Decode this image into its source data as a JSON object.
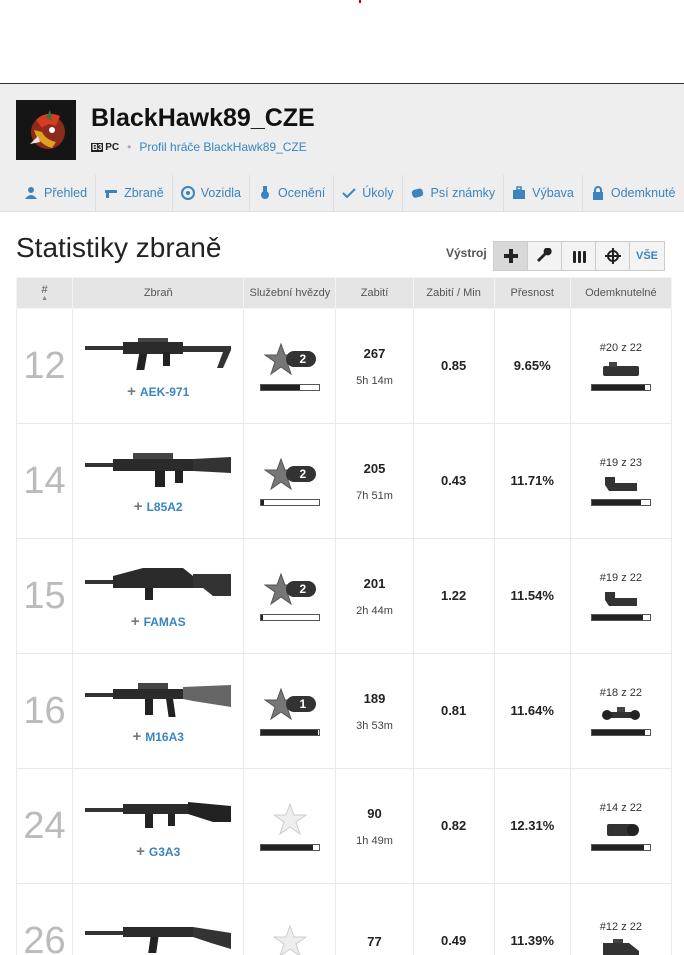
{
  "player": {
    "name": "BlackHawk89_CZE",
    "platform": "PC",
    "profile_link": "Profil hráče BlackHawk89_CZE"
  },
  "nav": [
    {
      "label": "Přehled",
      "icon": "user-icon"
    },
    {
      "label": "Zbraně",
      "icon": "gun-icon"
    },
    {
      "label": "Vozidla",
      "icon": "wheel-icon"
    },
    {
      "label": "Ocenění",
      "icon": "medal-icon"
    },
    {
      "label": "Úkoly",
      "icon": "check-icon"
    },
    {
      "label": "Psí známky",
      "icon": "dogtag-icon"
    },
    {
      "label": "Výbava",
      "icon": "briefcase-icon"
    },
    {
      "label": "Odemknuté",
      "icon": "lock-icon"
    }
  ],
  "page": {
    "title": "Statistiky zbraně",
    "filter_label": "Výstroj",
    "filter_all": "VŠE"
  },
  "table": {
    "headers": {
      "rank": "#",
      "weapon": "Zbraň",
      "stars": "Služební hvězdy",
      "kills": "Zabití",
      "kpm": "Zabití / Min",
      "accuracy": "Přesnost",
      "unlocks": "Odemknutelné"
    },
    "rows": [
      {
        "rank": "12",
        "weapon": "AEK-971",
        "stars": "2",
        "star_progress": 0.68,
        "kills": "267",
        "time": "5h 14m",
        "kpm": "0.85",
        "accuracy": "9.65%",
        "unlock": "#20 z 22",
        "unlock_progress": 0.92
      },
      {
        "rank": "14",
        "weapon": "L85A2",
        "stars": "2",
        "star_progress": 0.05,
        "kills": "205",
        "time": "7h 51m",
        "kpm": "0.43",
        "accuracy": "11.71%",
        "unlock": "#19 z 23",
        "unlock_progress": 0.85
      },
      {
        "rank": "15",
        "weapon": "FAMAS",
        "stars": "2",
        "star_progress": 0.03,
        "kills": "201",
        "time": "2h 44m",
        "kpm": "1.22",
        "accuracy": "11.54%",
        "unlock": "#19 z 22",
        "unlock_progress": 0.88
      },
      {
        "rank": "16",
        "weapon": "M16A3",
        "stars": "1",
        "star_progress": 0.98,
        "kills": "189",
        "time": "3h 53m",
        "kpm": "0.81",
        "accuracy": "11.64%",
        "unlock": "#18 z 22",
        "unlock_progress": 0.92
      },
      {
        "rank": "24",
        "weapon": "G3A3",
        "stars": "",
        "star_progress": 0.9,
        "kills": "90",
        "time": "1h 49m",
        "kpm": "0.82",
        "accuracy": "12.31%",
        "unlock": "#14 z 22",
        "unlock_progress": 0.9
      },
      {
        "rank": "26",
        "weapon": "",
        "stars": "",
        "star_progress": 0,
        "kills": "77",
        "time": "",
        "kpm": "0.49",
        "accuracy": "11.39%",
        "unlock": "#12 z 22",
        "unlock_progress": 0
      }
    ]
  }
}
